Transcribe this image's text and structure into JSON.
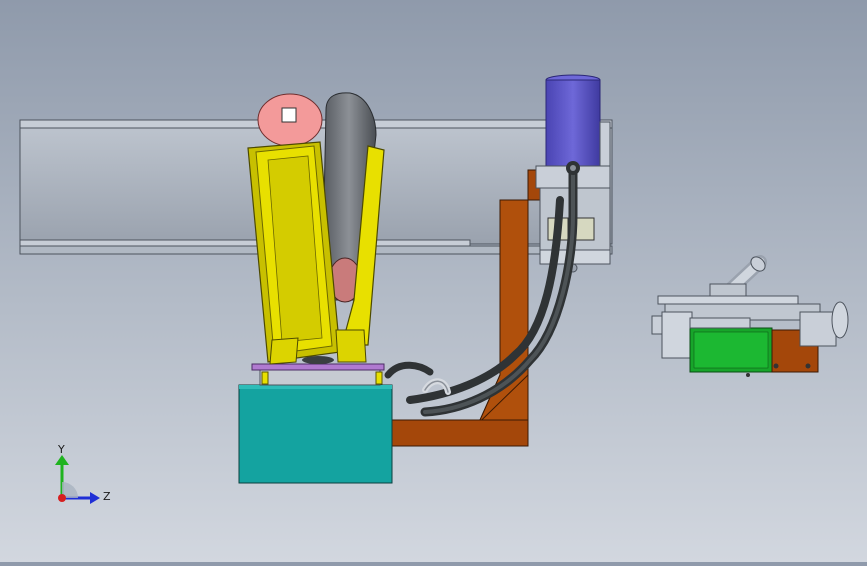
{
  "axis_triad": {
    "y_label": "Y",
    "z_label": "Z",
    "colors": {
      "y": "#1fb31f",
      "z": "#1f2fd6",
      "x": "#d61f1f"
    }
  },
  "colors": {
    "beam": "#a9b1bd",
    "robot_yellow": "#e8e000",
    "bracket_brown": "#a4470a",
    "base_teal": "#14a3a0",
    "motor_blue": "#5b55c7",
    "motor_green": "#17a52a",
    "cable_dark": "#3a3f41"
  },
  "parts": [
    "guide-rail-beam",
    "robot-arm",
    "robot-base",
    "l-bracket",
    "motor-housing",
    "cable-bundle",
    "gripper-assembly"
  ]
}
